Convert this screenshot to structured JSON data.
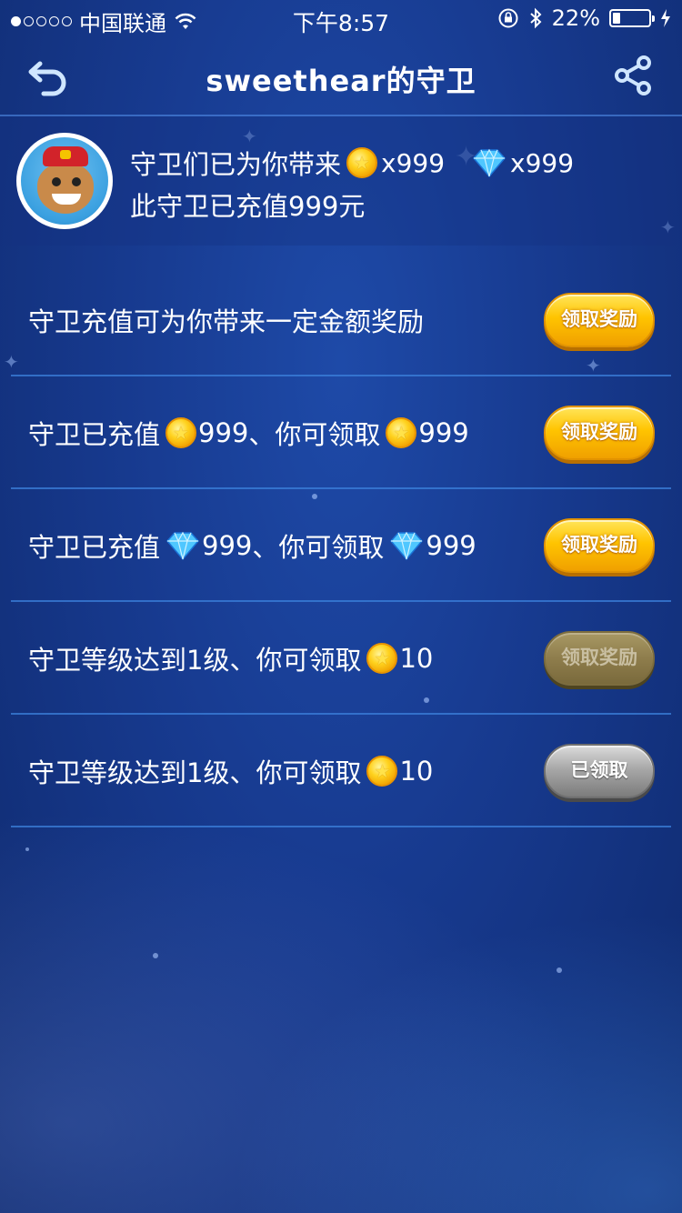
{
  "status_bar": {
    "carrier": "中国联通",
    "time": "下午8:57",
    "battery_percent": "22%",
    "battery_level": 0.22,
    "icons": [
      "wifi-icon",
      "orientation-lock-icon",
      "bluetooth-icon",
      "battery-icon",
      "charging-icon"
    ]
  },
  "nav": {
    "title": "sweethear的守卫",
    "back_icon": "back-arrow-icon",
    "share_icon": "share-icon"
  },
  "header": {
    "line1_prefix": "守卫们已为你带来",
    "coin_amount": "x999",
    "gem_amount": "x999",
    "line2": "此守卫已充值999元"
  },
  "rows": [
    {
      "text": "守卫充值可为你带来一定金额奖励",
      "button": "领取奖励",
      "state": "active"
    },
    {
      "prefix": "守卫已充值",
      "amount1": "999",
      "middle": "、你可领取",
      "amount2": "999",
      "icon": "coin-icon",
      "button": "领取奖励",
      "state": "active"
    },
    {
      "prefix": "守卫已充值",
      "amount1": "999",
      "middle": "、你可领取",
      "amount2": "999",
      "icon": "diamond-icon",
      "button": "领取奖励",
      "state": "active"
    },
    {
      "prefix": "守卫等级达到1级、你可领取",
      "amount": "10",
      "icon": "coin-icon",
      "button": "领取奖励",
      "state": "disabled"
    },
    {
      "prefix": "守卫等级达到1级、你可领取",
      "amount": "10",
      "icon": "coin-icon",
      "button": "已领取",
      "state": "claimed"
    }
  ],
  "colors": {
    "background": "#173a8f",
    "divider": "#3c82dc",
    "button_gold": "#ffc400",
    "button_disabled": "#8e7d4c",
    "button_claimed": "#a8a8a8"
  }
}
